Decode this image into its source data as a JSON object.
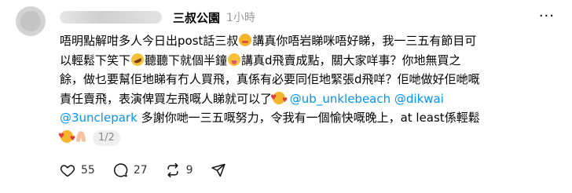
{
  "post": {
    "author": "三叔公園",
    "time": "1小時",
    "more_label": "···",
    "lines": [
      [
        "唔明點解咁多人今日出post話三叔",
        "講真你唔岩睇咪唔好睇，我一三五有節目可"
      ],
      [
        "以輕鬆下笑下",
        "聽聽下就個半鐘",
        "講真d飛賣成點，關大家咩事？你地無買之"
      ],
      [
        "餘，做乜要幫佢地睇有冇人買飛，真係有必要同佢地緊張d飛咩？佢哋做好佢哋嘅"
      ],
      [
        "責任賣飛，表演俾買左飛嘅人睇就可以了"
      ],
      [
        "多謝你哋一三五嘅努力，令我有一個愉快嘅晚上，at least係輕鬆"
      ]
    ],
    "mentions": [
      "@ub_unklebeach",
      "@dikwai",
      "@3unclepark"
    ],
    "page_indicator": "1/2",
    "emojis": [
      "smiling-face-with-hearts-icon",
      "rolling-on-floor-laughing-icon",
      "tongue-face-icon",
      "smiling-face-with-hearts-icon",
      "smiling-face-with-hearts-icon",
      "folded-hands-icon"
    ]
  },
  "actions": {
    "likes": "55",
    "replies": "27",
    "reposts": "9"
  },
  "colors": {
    "mention": "#0095f6",
    "muted": "#999999"
  }
}
